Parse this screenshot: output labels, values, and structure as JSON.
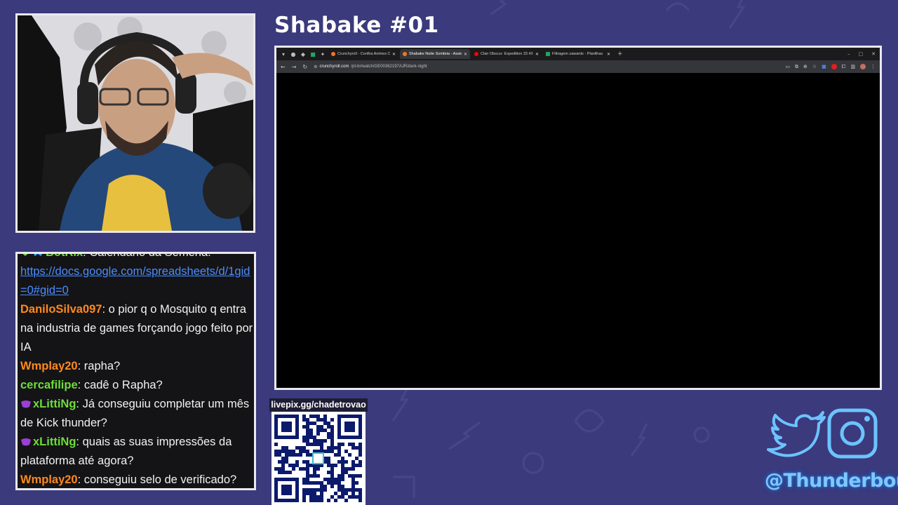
{
  "stream": {
    "title": "Shabake #01",
    "social_handle": "@Thunderbout",
    "livepix": "livepix.gg/chadetrovao"
  },
  "browser": {
    "tabs": [
      {
        "label": "Crunchyroll - Confira Animes O",
        "active": false,
        "color": "#f47521"
      },
      {
        "label": "Shabake Noite Sombria - Assis",
        "active": true,
        "color": "#f47521"
      },
      {
        "label": "Clair Obscur: Expedition 33 #0",
        "active": false,
        "color": "#ff0000"
      },
      {
        "label": "Filtragem zawards - Planilhas",
        "active": false,
        "color": "#1fa463"
      }
    ],
    "new_tab": "+",
    "url_host": "crunchyroll.com",
    "url_path": "/pt-br/watch/GE00362197AJR/dark-night"
  },
  "chat": {
    "messages": [
      {
        "user": "BotRix",
        "color": "#6fdc3c",
        "badges": [
          "green",
          "blue"
        ],
        "text": "Calendário da Semena:"
      },
      {
        "user": "",
        "color": "",
        "badges": [],
        "text": "",
        "link": "https://docs.google.com/spreadsheets/d/1gid=0#gid=0"
      },
      {
        "user": "DaniloSilva097",
        "color": "#ff8a1f",
        "badges": [],
        "text": "o pior q o Mosquito q entra na industria de games forçando jogo feito por IA"
      },
      {
        "user": "Wmplay20",
        "color": "#ff8a1f",
        "badges": [],
        "text": "rapha?"
      },
      {
        "user": "cercafilipe",
        "color": "#6fdc3c",
        "badges": [],
        "text": "cadê o Rapha?"
      },
      {
        "user": "xLittiNg",
        "color": "#6fdc3c",
        "badges": [
          "purple"
        ],
        "text": "Já conseguiu completar um mês de Kick thunder?"
      },
      {
        "user": "xLittiNg",
        "color": "#6fdc3c",
        "badges": [
          "purple"
        ],
        "text": "quais as suas impressões da plataforma até agora?"
      },
      {
        "user": "Wmplay20",
        "color": "#ff8a1f",
        "badges": [],
        "text": "conseguiu selo de verificado?"
      }
    ]
  },
  "icons": [
    "twitter-icon",
    "instagram-icon",
    "qr-code"
  ]
}
